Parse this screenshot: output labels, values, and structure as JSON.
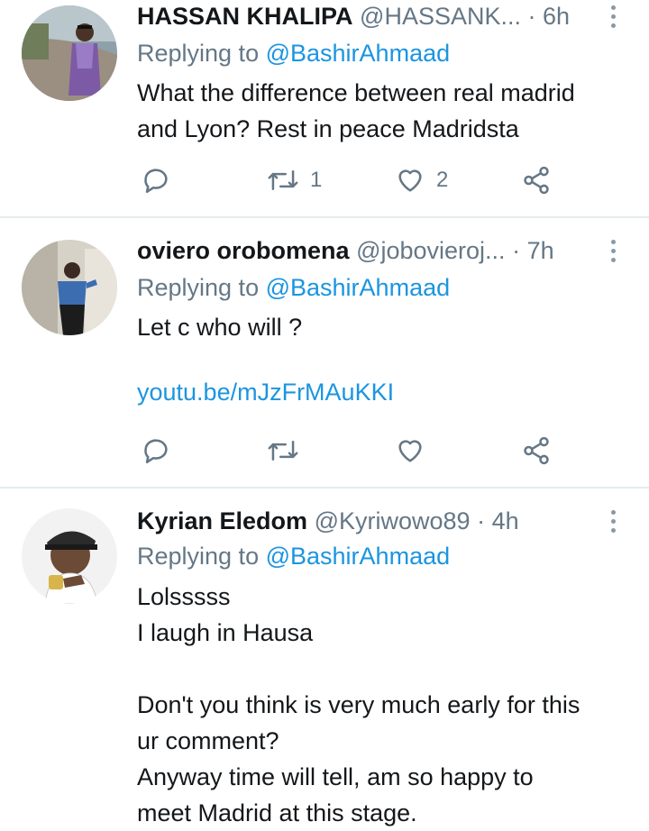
{
  "tweets": [
    {
      "name": "HASSAN KHALIPA",
      "handle": "@HASSANK...",
      "separator": "·",
      "time": "6h",
      "replying_prefix": "Replying to",
      "replying_handle": "@BashirAhmaad",
      "body_lines": [
        "What the difference between real madrid",
        "and Lyon?  Rest in peace Madridsta"
      ],
      "retweets": "1",
      "likes": "2"
    },
    {
      "name": "oviero orobomena",
      "handle": "@jobovieroj...",
      "separator": "·",
      "time": "7h",
      "replying_prefix": "Replying to",
      "replying_handle": "@BashirAhmaad",
      "body_lines": [
        "Let c who will ?"
      ],
      "link": "youtu.be/mJzFrMAuKKI",
      "retweets": "",
      "likes": ""
    },
    {
      "name": "Kyrian Eledom",
      "handle": "@Kyriwowo89",
      "separator": "·",
      "time": "4h",
      "replying_prefix": "Replying to",
      "replying_handle": "@BashirAhmaad",
      "body_lines": [
        "Lolsssss",
        "I laugh in Hausa",
        "Don't you think is very much early for this",
        "ur comment?",
        "Anyway time will tell, am so happy to",
        "meet Madrid at this stage."
      ]
    }
  ],
  "icons": {
    "reply": "reply-icon",
    "retweet": "retweet-icon",
    "like": "heart-icon",
    "share": "share-icon",
    "more": "more-vertical-icon"
  },
  "colors": {
    "link": "#1b95e0",
    "muted": "#657786",
    "text": "#14171a",
    "divider": "#e6ecf0"
  }
}
